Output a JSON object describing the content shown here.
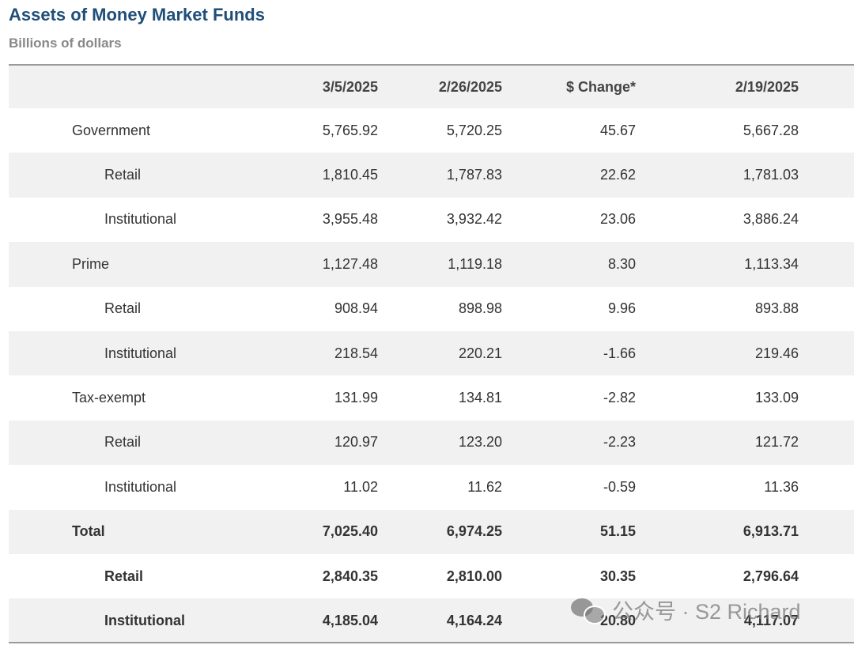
{
  "title": "Assets of Money Market Funds",
  "subtitle": "Billions of dollars",
  "columns": [
    "",
    "3/5/2025",
    "2/26/2025",
    "$ Change*",
    "2/19/2025"
  ],
  "rows": [
    {
      "label": "Government",
      "values": [
        "5,765.92",
        "5,720.25",
        "45.67",
        "5,667.28"
      ]
    },
    {
      "label": "Retail",
      "values": [
        "1,810.45",
        "1,787.83",
        "22.62",
        "1,781.03"
      ]
    },
    {
      "label": "Institutional",
      "values": [
        "3,955.48",
        "3,932.42",
        "23.06",
        "3,886.24"
      ]
    },
    {
      "label": "Prime",
      "values": [
        "1,127.48",
        "1,119.18",
        "8.30",
        "1,113.34"
      ]
    },
    {
      "label": "Retail",
      "values": [
        "908.94",
        "898.98",
        "9.96",
        "893.88"
      ]
    },
    {
      "label": "Institutional",
      "values": [
        "218.54",
        "220.21",
        "-1.66",
        "219.46"
      ]
    },
    {
      "label": "Tax-exempt",
      "values": [
        "131.99",
        "134.81",
        "-2.82",
        "133.09"
      ]
    },
    {
      "label": "Retail",
      "values": [
        "120.97",
        "123.20",
        "-2.23",
        "121.72"
      ]
    },
    {
      "label": "Institutional",
      "values": [
        "11.02",
        "11.62",
        "-0.59",
        "11.36"
      ]
    },
    {
      "label": "Total",
      "values": [
        "7,025.40",
        "6,974.25",
        "51.15",
        "6,913.71"
      ]
    },
    {
      "label": "Retail",
      "values": [
        "2,840.35",
        "2,810.00",
        "30.35",
        "2,796.64"
      ]
    },
    {
      "label": "Institutional",
      "values": [
        "4,185.04",
        "4,164.24",
        "20.80",
        "4,117.07"
      ]
    }
  ],
  "watermark": {
    "icon": "wechat-icon",
    "text": "公众号 · S2 Richard"
  }
}
